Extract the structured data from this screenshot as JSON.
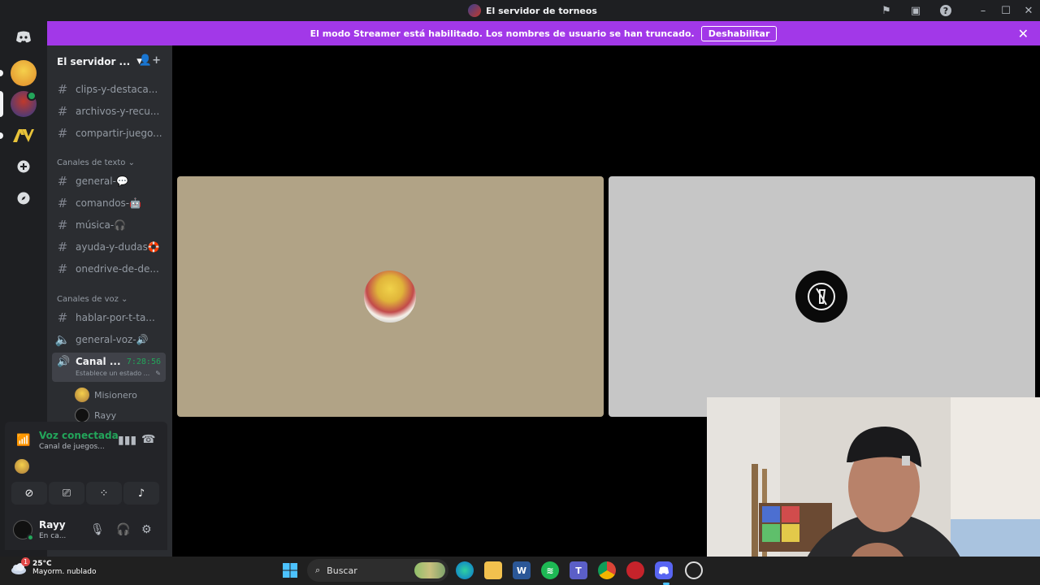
{
  "window": {
    "title": "El servidor de torneos"
  },
  "banner": {
    "message": "El modo Streamer está habilitado. Los nombres de usuario se han truncado.",
    "button_label": "Deshabilitar"
  },
  "server": {
    "name": "El servidor ..."
  },
  "channels": {
    "top": [
      {
        "label": "clips-y-destaca..."
      },
      {
        "label": "archivos-y-recu..."
      },
      {
        "label": "compartir-juego..."
      }
    ],
    "text_category": "Canales de texto",
    "text": [
      {
        "label": "general-💬"
      },
      {
        "label": "comandos-🤖"
      },
      {
        "label": "música-🎧"
      },
      {
        "label": "ayuda-y-dudas🛟"
      },
      {
        "label": "onedrive-de-de..."
      }
    ],
    "voice_category": "Canales de voz",
    "voice": [
      {
        "label": "hablar-por-t-ta..."
      },
      {
        "label": "general-voz-🔊"
      }
    ],
    "active_voice": {
      "name": "Canal ...",
      "time": "7:28:56",
      "status": "Establece un estado ..."
    },
    "voice_users": [
      {
        "name": "Misionero"
      },
      {
        "name": "Rayy"
      }
    ]
  },
  "voice_panel": {
    "title": "Voz conectada",
    "subtitle": "Canal de juegos..."
  },
  "user": {
    "name": "Rayy",
    "status": "En ca..."
  },
  "taskbar": {
    "temperature": "25°C",
    "weather": "Mayorm. nublado",
    "weather_badge": "1",
    "search_placeholder": "Buscar"
  },
  "colors": {
    "accent": "#a238e8",
    "online": "#23a55a",
    "tile_left": "#b1a386",
    "tile_right": "#c6c6c6"
  }
}
